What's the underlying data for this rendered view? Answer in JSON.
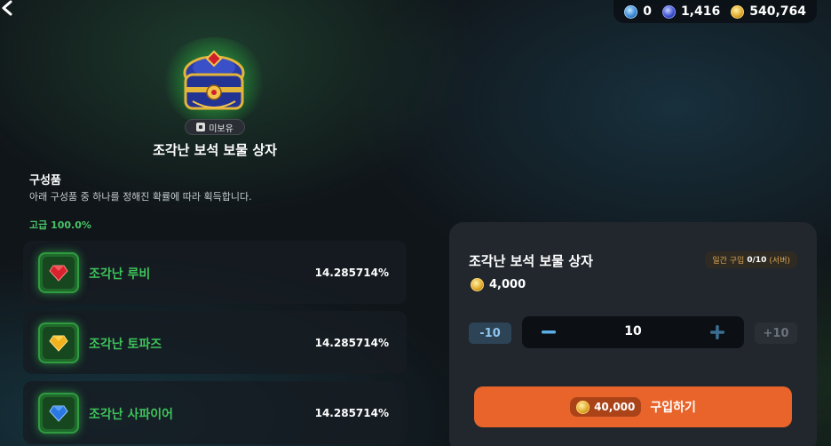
{
  "nav": {
    "back_icon": "chevron-left-icon"
  },
  "currencies": [
    {
      "icon": "crystal-icon",
      "value": "0"
    },
    {
      "icon": "blue-gem-icon",
      "value": "1,416"
    },
    {
      "icon": "gold-coin-icon",
      "value": "540,764"
    }
  ],
  "item": {
    "name": "조각난 보석 보물 상자",
    "ownership_badge": "미보유"
  },
  "components": {
    "title": "구성품",
    "description": "아래 구성품 중 하나를 정해진 확률에 따라 획득합니다.",
    "grade_label": "고급 100.0%",
    "items": [
      {
        "name": "조각난 루비",
        "rate": "14.285714%",
        "gem_icon": "ruby-icon",
        "gem_color": "#d8232f"
      },
      {
        "name": "조각난 토파즈",
        "rate": "14.285714%",
        "gem_icon": "topaz-icon",
        "gem_color": "#f0b21e"
      },
      {
        "name": "조각난 사파이어",
        "rate": "14.285714%",
        "gem_icon": "sapphire-icon",
        "gem_color": "#2a78e4"
      }
    ]
  },
  "purchase": {
    "title": "조각난 보석 보물 상자",
    "limit_prefix": "일간 구입",
    "limit_count": "0/10",
    "limit_suffix": "(서버)",
    "unit_price": "4,000",
    "minus10_label": "-10",
    "plus10_label": "+10",
    "quantity": "10",
    "total_price": "40,000",
    "buy_label": "구입하기"
  },
  "colors": {
    "accent_orange": "#e8642b",
    "grade_green": "#49c467",
    "panel_bg": "#22272e"
  }
}
